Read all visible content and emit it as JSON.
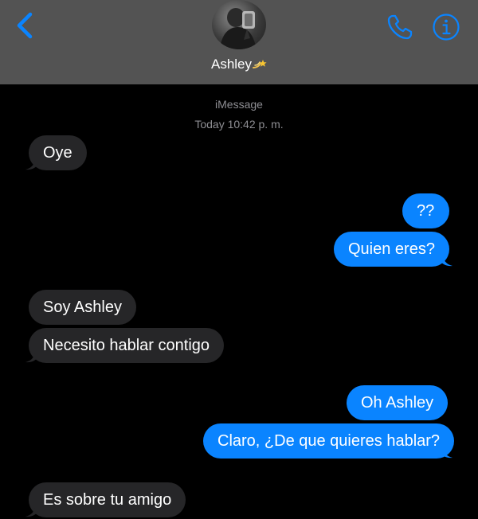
{
  "header": {
    "contact_name": "Ashley",
    "back_icon": "chevron-left-icon",
    "call_icon": "phone-icon",
    "info_icon": "info-icon",
    "emoji_icon": "dizzy-emoji-icon",
    "background_color": "#535353",
    "accent_color": "#0a84ff"
  },
  "conversation": {
    "service": "iMessage",
    "timestamp": "Today 10:42 p. m."
  },
  "messages": [
    {
      "sender": "contact",
      "text": "Oye"
    },
    {
      "sender": "me",
      "text": "??"
    },
    {
      "sender": "me",
      "text": "Quien eres?"
    },
    {
      "sender": "contact",
      "text": "Soy Ashley"
    },
    {
      "sender": "contact",
      "text": "Necesito hablar contigo"
    },
    {
      "sender": "me",
      "text": "Oh Ashley"
    },
    {
      "sender": "me",
      "text": "Claro, ¿De que quieres hablar?"
    },
    {
      "sender": "contact",
      "text": "Es sobre tu amigo"
    }
  ],
  "colors": {
    "incoming_bubble": "#262628",
    "outgoing_bubble": "#0a84ff",
    "meta_text": "#8e8e93",
    "background": "#000000"
  }
}
